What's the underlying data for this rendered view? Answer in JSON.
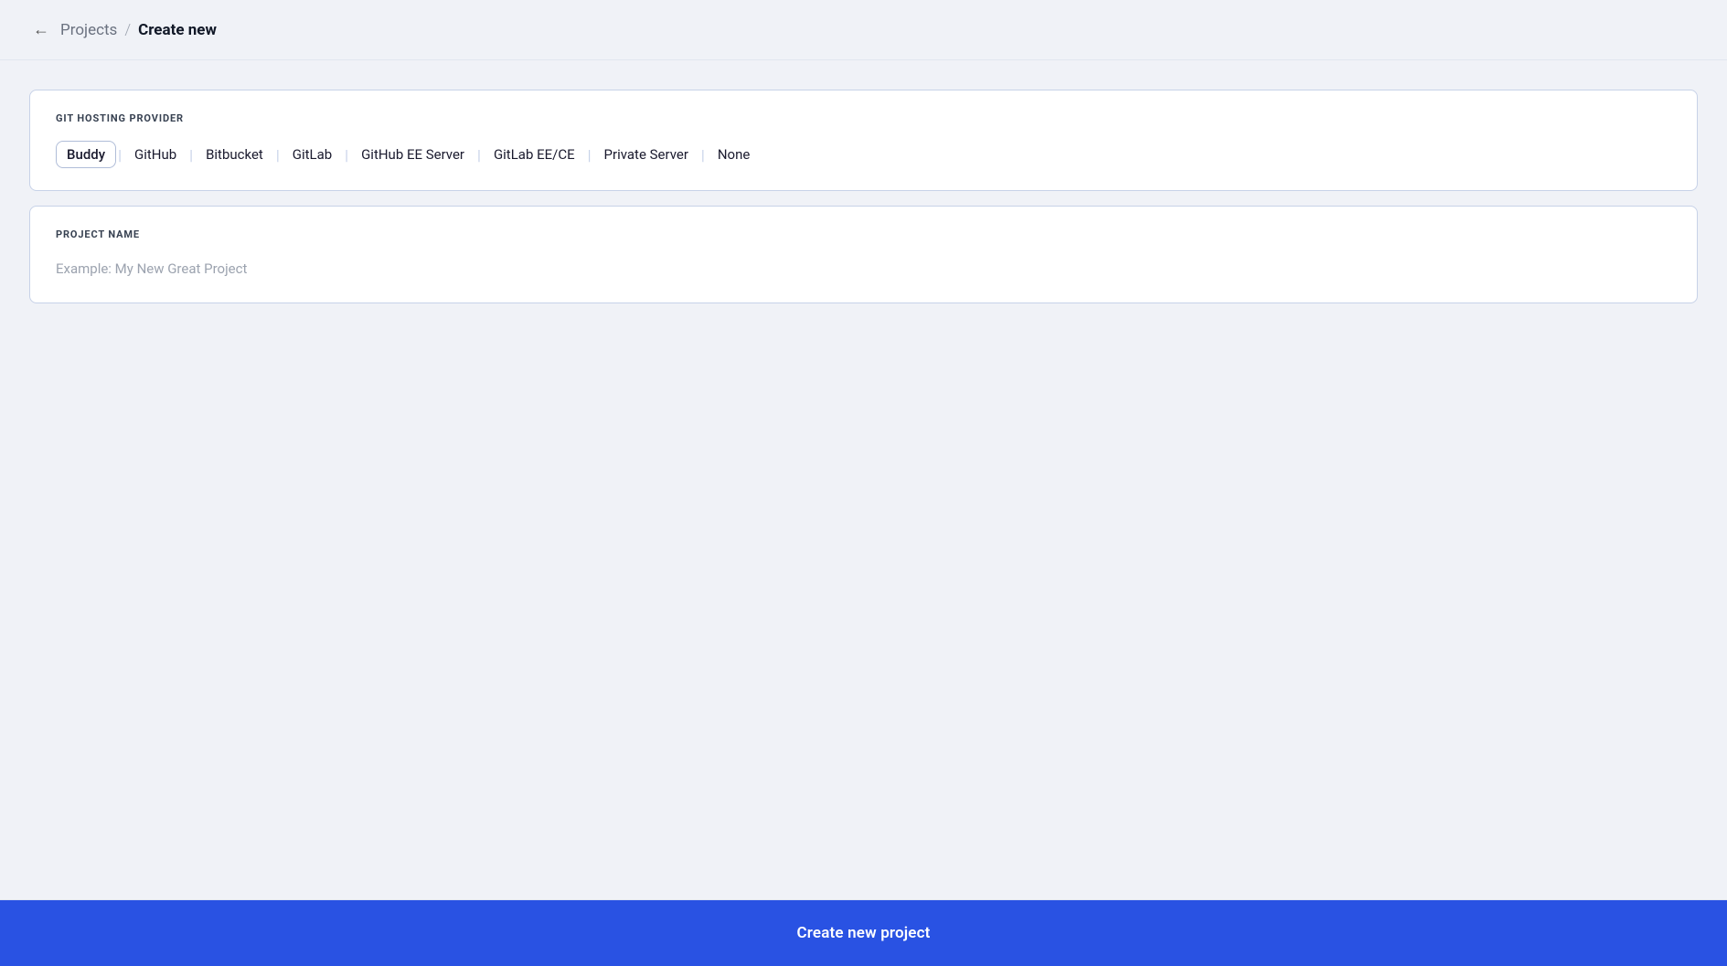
{
  "header": {
    "back_label": "←",
    "breadcrumb_parent": "Projects",
    "breadcrumb_separator": "/",
    "breadcrumb_current": "Create new"
  },
  "git_hosting": {
    "label": "GIT HOSTING PROVIDER",
    "providers": [
      {
        "id": "buddy",
        "label": "Buddy",
        "active": true
      },
      {
        "id": "github",
        "label": "GitHub",
        "active": false
      },
      {
        "id": "bitbucket",
        "label": "Bitbucket",
        "active": false
      },
      {
        "id": "gitlab",
        "label": "GitLab",
        "active": false
      },
      {
        "id": "github-ee",
        "label": "GitHub EE Server",
        "active": false
      },
      {
        "id": "gitlab-ee",
        "label": "GitLab EE/CE",
        "active": false
      },
      {
        "id": "private-server",
        "label": "Private Server",
        "active": false
      },
      {
        "id": "none",
        "label": "None",
        "active": false
      }
    ]
  },
  "project_name": {
    "label": "PROJECT NAME",
    "placeholder": "Example: My New Great Project"
  },
  "footer": {
    "create_button_label": "Create new project"
  }
}
